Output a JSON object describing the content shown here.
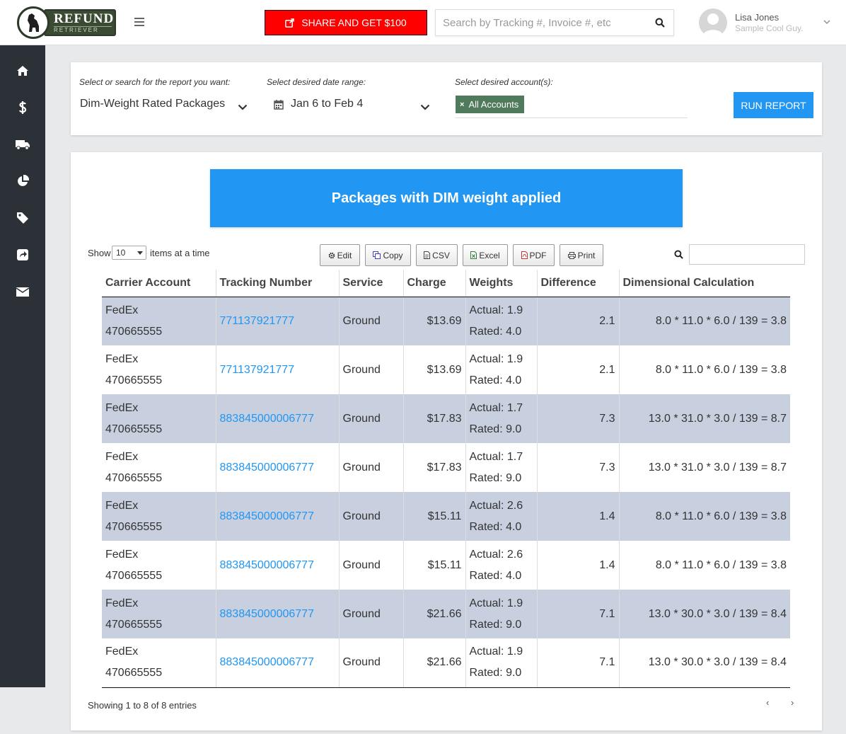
{
  "logo": {
    "main": "REFUND",
    "sub": "RETRIEVER"
  },
  "header": {
    "share_label": "SHARE AND GET $100",
    "search_placeholder": "Search by Tracking #, Invoice #, etc",
    "user_name": "Lisa Jones",
    "user_sub": "Sample Cool Guy."
  },
  "sidebar": {
    "items": [
      {
        "icon": "home-icon"
      },
      {
        "icon": "dollar-icon"
      },
      {
        "icon": "truck-icon"
      },
      {
        "icon": "pie-chart-icon"
      },
      {
        "icon": "tag-icon"
      },
      {
        "icon": "share-icon"
      },
      {
        "icon": "envelope-icon"
      }
    ]
  },
  "filters": {
    "report_label": "Select or search for the report you want:",
    "report_value": "Dim-Weight Rated Packages",
    "date_label": "Select desired date range:",
    "date_value": "Jan 6 to Feb 4",
    "account_label": "Select desired account(s):",
    "account_tag": "All Accounts",
    "run_label": "RUN REPORT"
  },
  "report": {
    "title": "Packages with DIM weight applied",
    "show_label": "Show",
    "page_length": "10",
    "items_label": "items at a time",
    "buttons": {
      "edit": "Edit",
      "copy": "Copy",
      "csv": "CSV",
      "excel": "Excel",
      "pdf": "PDF",
      "print": "Print"
    },
    "columns": [
      "Carrier Account",
      "Tracking Number",
      "Service",
      "Charge",
      "Weights",
      "Difference",
      "Dimensional Calculation"
    ],
    "rows": [
      {
        "carrier": "FedEx",
        "account": "470665555",
        "tracking": "771137921777",
        "service": "Ground",
        "charge": "$13.69",
        "actual": "Actual: 1.9",
        "rated": "Rated: 4.0",
        "difference": "2.1",
        "calc": "8.0 * 11.0 * 6.0 / 139 = 3.8"
      },
      {
        "carrier": "FedEx",
        "account": "470665555",
        "tracking": "771137921777",
        "service": "Ground",
        "charge": "$13.69",
        "actual": "Actual: 1.9",
        "rated": "Rated: 4.0",
        "difference": "2.1",
        "calc": "8.0 * 11.0 * 6.0 / 139 = 3.8"
      },
      {
        "carrier": "FedEx",
        "account": "470665555",
        "tracking": "883845000006777",
        "service": "Ground",
        "charge": "$17.83",
        "actual": "Actual: 1.7",
        "rated": "Rated: 9.0",
        "difference": "7.3",
        "calc": "13.0 * 31.0 * 3.0 / 139 = 8.7"
      },
      {
        "carrier": "FedEx",
        "account": "470665555",
        "tracking": "883845000006777",
        "service": "Ground",
        "charge": "$17.83",
        "actual": "Actual: 1.7",
        "rated": "Rated: 9.0",
        "difference": "7.3",
        "calc": "13.0 * 31.0 * 3.0 / 139 = 8.7"
      },
      {
        "carrier": "FedEx",
        "account": "470665555",
        "tracking": "883845000006777",
        "service": "Ground",
        "charge": "$15.11",
        "actual": "Actual: 2.6",
        "rated": "Rated: 4.0",
        "difference": "1.4",
        "calc": "8.0 * 11.0 * 6.0 / 139 = 3.8"
      },
      {
        "carrier": "FedEx",
        "account": "470665555",
        "tracking": "883845000006777",
        "service": "Ground",
        "charge": "$15.11",
        "actual": "Actual: 2.6",
        "rated": "Rated: 4.0",
        "difference": "1.4",
        "calc": "8.0 * 11.0 * 6.0 / 139 = 3.8"
      },
      {
        "carrier": "FedEx",
        "account": "470665555",
        "tracking": "883845000006777",
        "service": "Ground",
        "charge": "$21.66",
        "actual": "Actual: 1.9",
        "rated": "Rated: 9.0",
        "difference": "7.1",
        "calc": "13.0 * 30.0 * 3.0 / 139 = 8.4"
      },
      {
        "carrier": "FedEx",
        "account": "470665555",
        "tracking": "883845000006777",
        "service": "Ground",
        "charge": "$21.66",
        "actual": "Actual: 1.9",
        "rated": "Rated: 9.0",
        "difference": "7.1",
        "calc": "13.0 * 30.0 * 3.0 / 139 = 8.4"
      }
    ],
    "info": "Showing 1 to 8 of 8 entries",
    "prev": "‹",
    "next": "›"
  },
  "colors": {
    "accent": "#2196f3",
    "share": "#ff0000",
    "sidebar": "#2b3137",
    "tag": "#4f7a5c",
    "stripe": "#c8d0e0"
  }
}
